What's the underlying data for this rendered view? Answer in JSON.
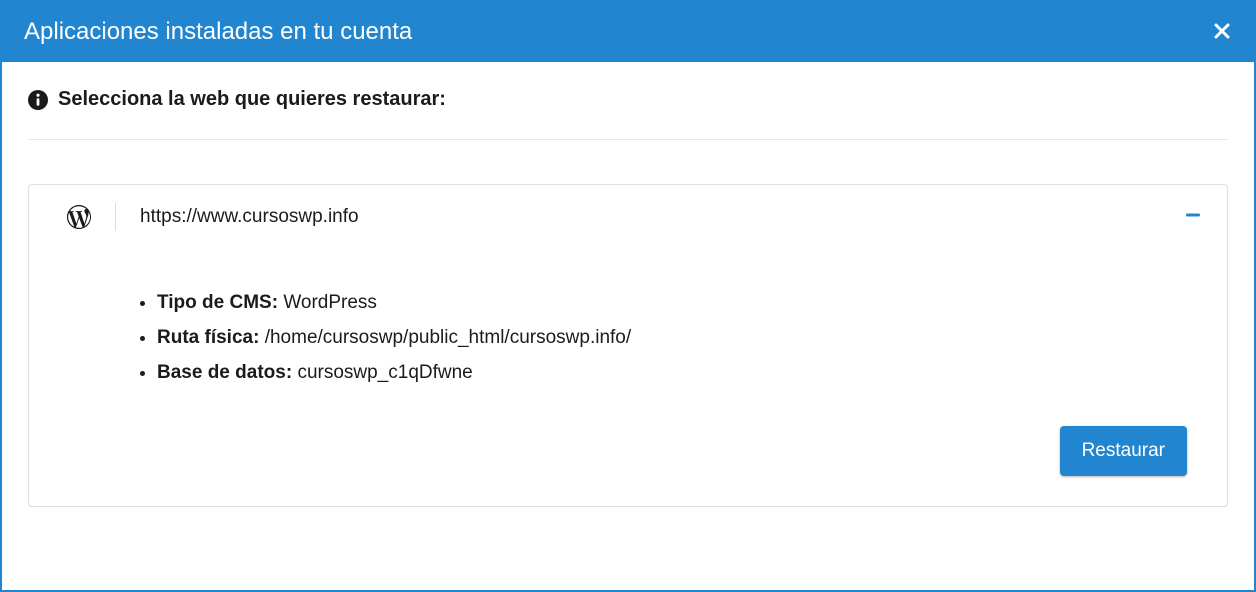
{
  "header": {
    "title": "Aplicaciones instaladas en tu cuenta"
  },
  "subtitle": "Selecciona la web que quieres restaurar:",
  "site": {
    "url": "https://www.cursoswp.info",
    "details": {
      "cms_label": "Tipo de CMS:",
      "cms_value": "WordPress",
      "path_label": "Ruta física:",
      "path_value": "/home/cursoswp/public_html/cursoswp.info/",
      "db_label": "Base de datos:",
      "db_value": "cursoswp_c1qDfwne"
    }
  },
  "actions": {
    "restore": "Restaurar"
  }
}
